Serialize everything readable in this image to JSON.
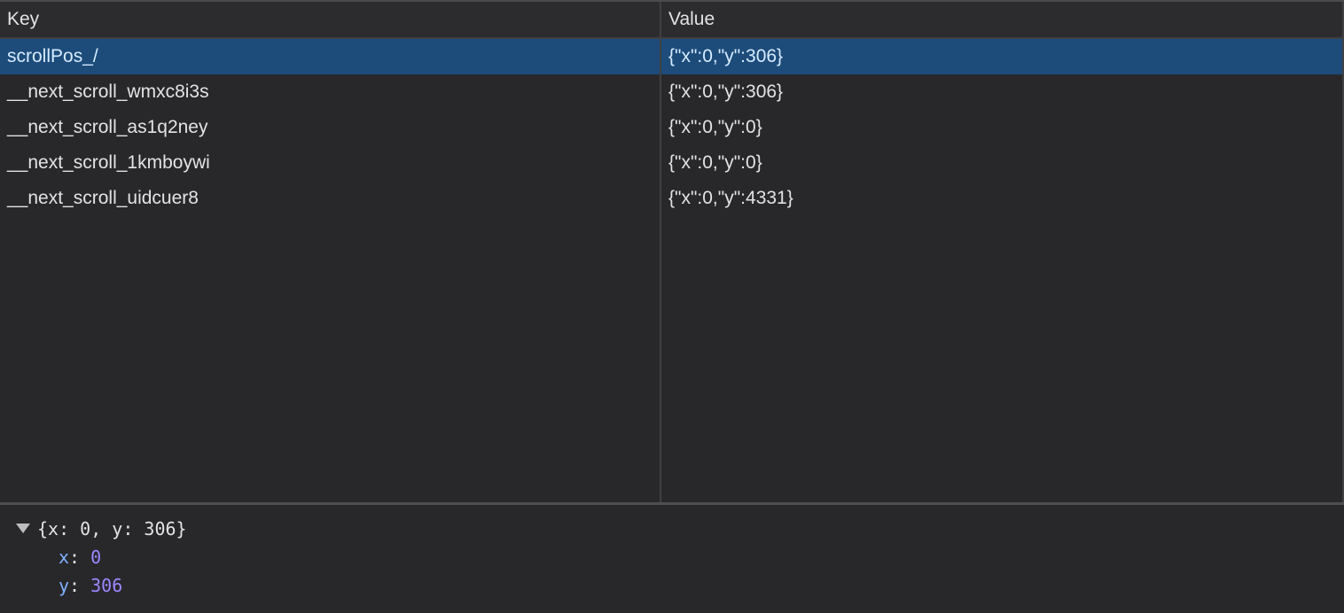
{
  "table": {
    "columns": {
      "key": "Key",
      "value": "Value"
    },
    "rows": [
      {
        "key": "scrollPos_/",
        "value": "{\"x\":0,\"y\":306}",
        "selected": true
      },
      {
        "key": "__next_scroll_wmxc8i3s",
        "value": "{\"x\":0,\"y\":306}",
        "selected": false
      },
      {
        "key": "__next_scroll_as1q2ney",
        "value": "{\"x\":0,\"y\":0}",
        "selected": false
      },
      {
        "key": "__next_scroll_1kmboywi",
        "value": "{\"x\":0,\"y\":0}",
        "selected": false
      },
      {
        "key": "__next_scroll_uidcuer8",
        "value": "{\"x\":0,\"y\":4331}",
        "selected": false
      }
    ]
  },
  "preview": {
    "summary": "{x: 0, y: 306}",
    "props": [
      {
        "name": "x",
        "value": "0"
      },
      {
        "name": "y",
        "value": "306"
      }
    ]
  },
  "colors": {
    "background": "#28282b",
    "selected_row": "#1d4c7a",
    "property_name": "#7fb2ff",
    "number_value": "#9d86ff"
  },
  "icons": {
    "expand": "disclosure-triangle-down-icon"
  }
}
